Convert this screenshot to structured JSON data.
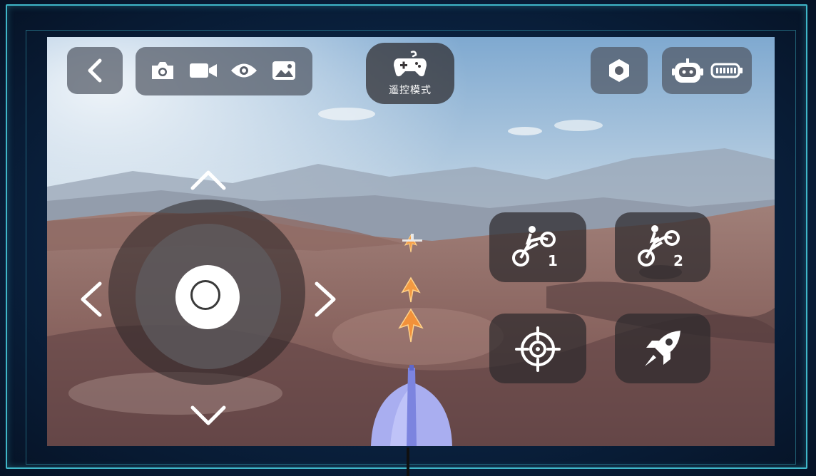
{
  "app": {
    "mode_label": "遥控模式"
  },
  "toolbar": {
    "back": "back-icon",
    "camera": "camera-icon",
    "video": "video-icon",
    "view": "eye-icon",
    "gallery": "image-icon",
    "settings": "hexagon-icon",
    "robot": "robot-icon",
    "battery": "battery-icon"
  },
  "actions": {
    "stunt1_label": "1",
    "stunt2_label": "2",
    "aim": "crosshair-icon",
    "launch": "rocket-icon"
  },
  "colors": {
    "frame": "#3fb7c9",
    "glass": "#505864",
    "projectile": "#f5a04a"
  }
}
